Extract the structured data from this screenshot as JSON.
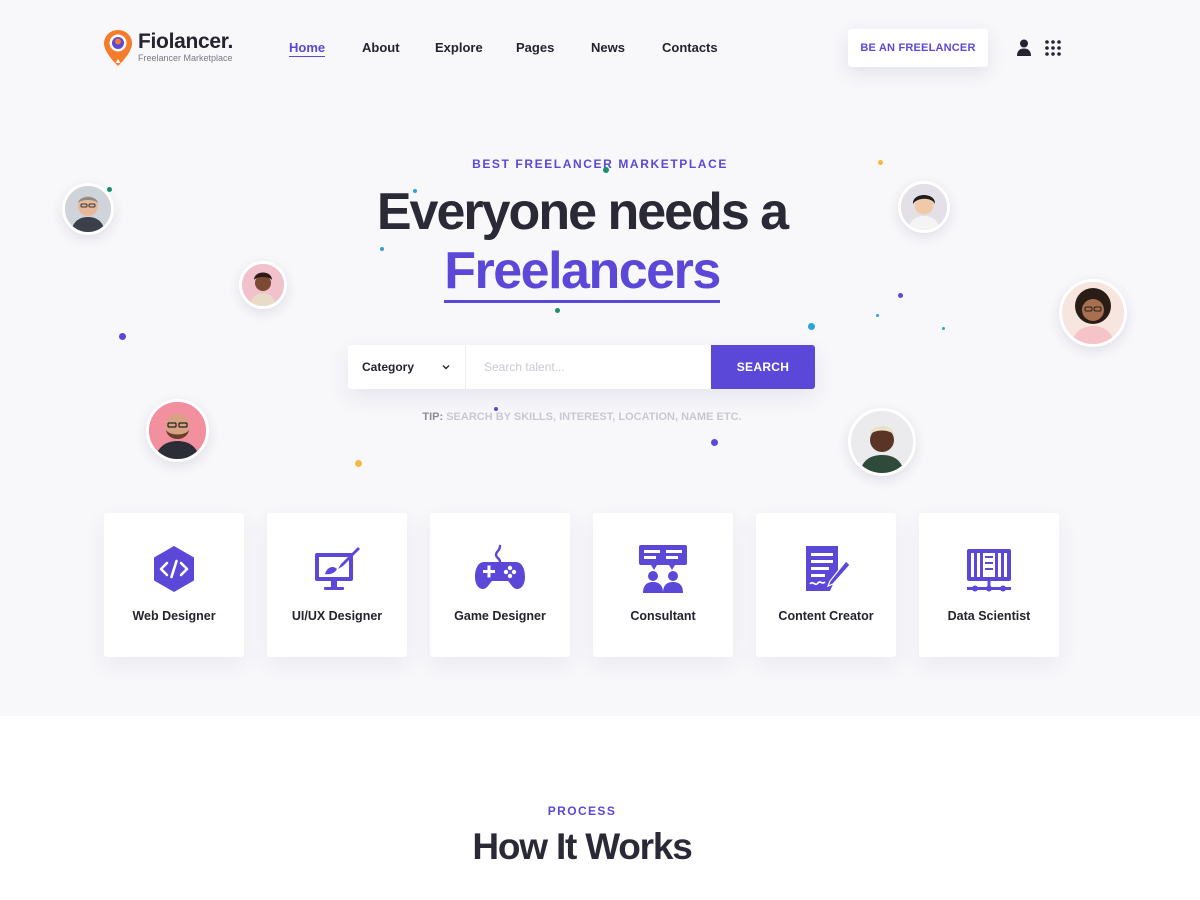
{
  "brand": {
    "name": "Fiolancer.",
    "tagline": "Freelancer Marketplace",
    "logo_icon": "location-pin-icon",
    "accent_color": "#5b48d8",
    "logo_color": "#f57c2a"
  },
  "nav": {
    "items": [
      {
        "label": "Home",
        "active": true
      },
      {
        "label": "About",
        "active": false
      },
      {
        "label": "Explore",
        "active": false
      },
      {
        "label": "Pages",
        "active": false
      },
      {
        "label": "News",
        "active": false
      },
      {
        "label": "Contacts",
        "active": false
      }
    ],
    "cta_label": "BE AN FREELANCER",
    "user_icon": "user-icon",
    "menu_icon": "grid-menu-icon"
  },
  "hero": {
    "eyebrow": "BEST FREELANCER MARKETPLACE",
    "headline_line1": "Everyone needs a",
    "headline_line2": "Freelancers",
    "search": {
      "category_label": "Category",
      "placeholder": "Search talent...",
      "button_label": "SEARCH"
    },
    "tip_prefix": "TIP:",
    "tip_text": "SEARCH BY SKILLS, INTEREST, LOCATION, NAME ETC."
  },
  "categories": [
    {
      "label": "Web Designer",
      "icon": "code-hexagon-icon"
    },
    {
      "label": "UI/UX Designer",
      "icon": "monitor-brush-icon"
    },
    {
      "label": "Game Designer",
      "icon": "gamepad-icon"
    },
    {
      "label": "Consultant",
      "icon": "consultation-icon"
    },
    {
      "label": "Content Creator",
      "icon": "document-pen-icon"
    },
    {
      "label": "Data Scientist",
      "icon": "server-data-icon"
    }
  ],
  "process": {
    "eyebrow": "PROCESS",
    "title": "How It Works"
  }
}
